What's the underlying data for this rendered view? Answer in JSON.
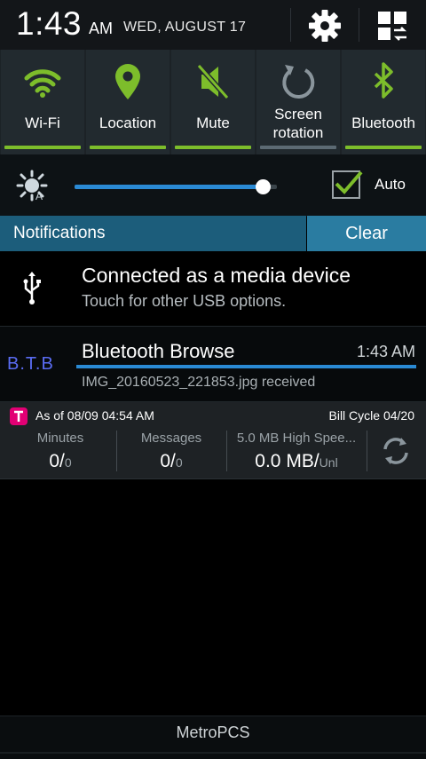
{
  "status": {
    "time": "1:43",
    "ampm": "AM",
    "date": "WED, AUGUST 17"
  },
  "quick_settings": [
    {
      "label": "Wi-Fi",
      "icon": "wifi-icon",
      "active": true
    },
    {
      "label": "Location",
      "icon": "location-pin-icon",
      "active": true
    },
    {
      "label": "Mute",
      "icon": "mute-icon",
      "active": true
    },
    {
      "label": "Screen rotation",
      "line1": "Screen",
      "line2": "rotation",
      "icon": "rotation-icon",
      "active": false
    },
    {
      "label": "Bluetooth",
      "icon": "bluetooth-icon",
      "active": true
    }
  ],
  "brightness": {
    "level": 0.93,
    "auto_label": "Auto",
    "auto_checked": true
  },
  "notifications_header": {
    "title": "Notifications",
    "clear": "Clear"
  },
  "notifications": {
    "usb": {
      "title": "Connected as a media device",
      "subtitle": "Touch for other USB options."
    },
    "bluetooth": {
      "app_label": "B.T.B",
      "title": "Bluetooth Browse",
      "time": "1:43 AM",
      "subtitle": "IMG_20160523_221853.jpg received",
      "progress": 1.0
    },
    "usage": {
      "as_of": "As of  08/09 04:54 AM",
      "bill_cycle": "Bill Cycle 04/20",
      "columns": [
        {
          "header": "Minutes",
          "value": "0/",
          "unit": "0"
        },
        {
          "header": "Messages",
          "value": "0/",
          "unit": "0"
        },
        {
          "header": "5.0 MB High Spee...",
          "value": "0.0 MB/",
          "unit": "Unl"
        }
      ]
    }
  },
  "carrier": "MetroPCS",
  "colors": {
    "active": "#7dbd2b",
    "inactive": "#5c6a73",
    "accent": "#2a8ad4",
    "header": "#1c5d7b"
  }
}
